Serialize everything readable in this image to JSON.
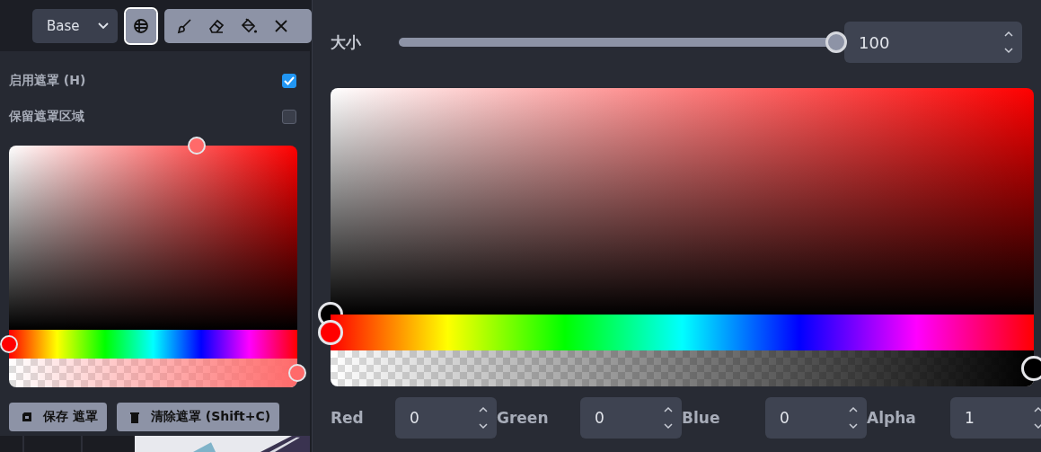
{
  "toolbar": {
    "layer_select": {
      "value": "Base"
    },
    "tools": [
      {
        "kind": "mask",
        "selected": true
      },
      {
        "kind": "brush",
        "selected": false
      },
      {
        "kind": "eraser",
        "selected": false
      },
      {
        "kind": "fill",
        "selected": false
      },
      {
        "kind": "close",
        "selected": false
      }
    ]
  },
  "mask_panel": {
    "options": [
      {
        "label": "启用遮罩 (H)",
        "checked": true
      },
      {
        "label": "保留遮罩区域",
        "checked": false
      }
    ],
    "picker": {
      "color": "#ff6a6a",
      "hue": {
        "level": 0
      },
      "alpha": {
        "level": 1
      }
    },
    "buttons": [
      {
        "kind": "save",
        "label": "保存 遮罩"
      },
      {
        "kind": "clear",
        "label": "清除遮罩 (Shift+C)"
      }
    ]
  },
  "brush_popover": {
    "size": {
      "label": "大小",
      "level": 1,
      "value": "100"
    },
    "picker": {
      "color": "#000000",
      "hue": {
        "level": 0
      },
      "alpha": {
        "level": 1
      }
    },
    "channels": [
      {
        "label": "Red",
        "value": "0"
      },
      {
        "label": "Green",
        "value": "0"
      },
      {
        "label": "Blue",
        "value": "0"
      },
      {
        "label": "Alpha",
        "value": "1"
      }
    ]
  }
}
